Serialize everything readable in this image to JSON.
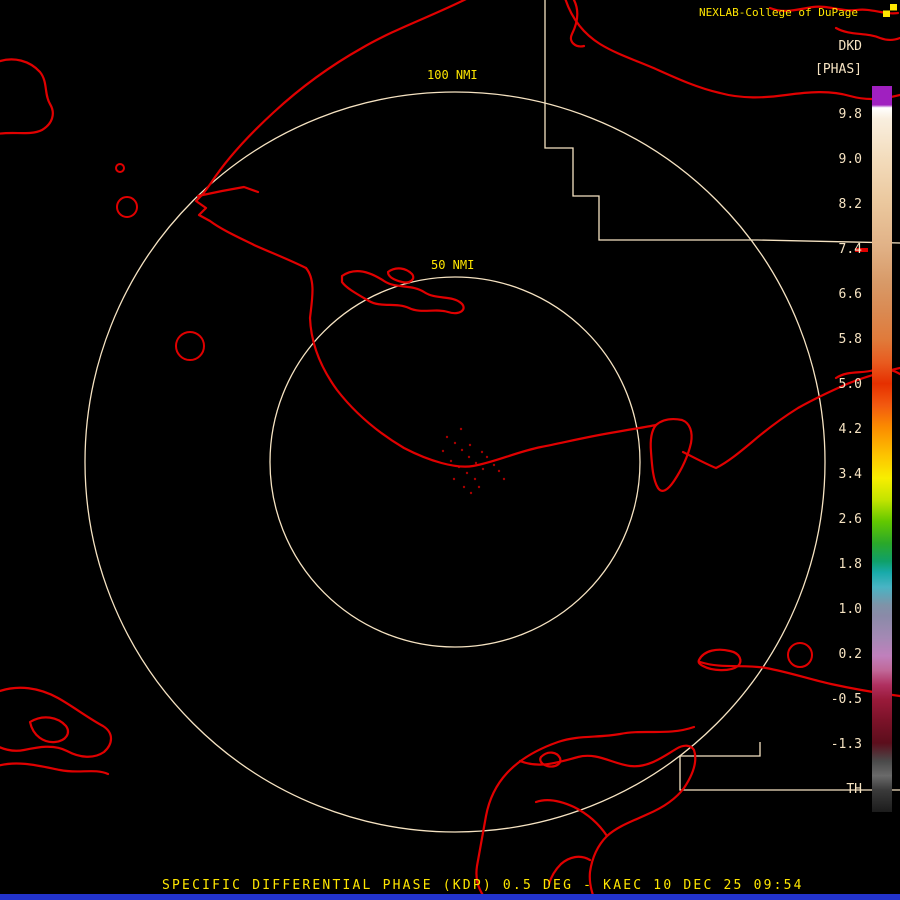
{
  "header": {
    "title": "NEXLAB-College of DuPage",
    "product_code": "DKD",
    "product_units": "[PHAS]"
  },
  "rings": {
    "outer_label": "100 NMI",
    "inner_label": "50 NMI"
  },
  "colorbar": {
    "tick_labels": [
      "9.8",
      "9.0",
      "8.2",
      "7.4",
      "6.6",
      "5.8",
      "5.0",
      "4.2",
      "3.4",
      "2.6",
      "1.8",
      "1.0",
      "0.2",
      "-0.5",
      "-1.3",
      "TH"
    ],
    "gradient_stops": [
      {
        "pos": 0,
        "color": "#a020c0"
      },
      {
        "pos": 2.6,
        "color": "#a020c0"
      },
      {
        "pos": 3.0,
        "color": "#ffffff"
      },
      {
        "pos": 4.5,
        "color": "#f9efdf"
      },
      {
        "pos": 10,
        "color": "#f3dcbc"
      },
      {
        "pos": 16,
        "color": "#ebc89e"
      },
      {
        "pos": 22,
        "color": "#e1b287"
      },
      {
        "pos": 27,
        "color": "#d89a68"
      },
      {
        "pos": 31,
        "color": "#da8a52"
      },
      {
        "pos": 35,
        "color": "#e07a3a"
      },
      {
        "pos": 38,
        "color": "#e85c20"
      },
      {
        "pos": 41,
        "color": "#e63000"
      },
      {
        "pos": 44,
        "color": "#f25a10"
      },
      {
        "pos": 47,
        "color": "#fb8c00"
      },
      {
        "pos": 51,
        "color": "#fdc500"
      },
      {
        "pos": 54,
        "color": "#f8ee00"
      },
      {
        "pos": 57,
        "color": "#c3e400"
      },
      {
        "pos": 60,
        "color": "#62c800"
      },
      {
        "pos": 63,
        "color": "#2aa82a"
      },
      {
        "pos": 65.5,
        "color": "#0fa06a"
      },
      {
        "pos": 67,
        "color": "#18aaaa"
      },
      {
        "pos": 69,
        "color": "#49b4c4"
      },
      {
        "pos": 71.5,
        "color": "#7f93a8"
      },
      {
        "pos": 73,
        "color": "#8a8aa8"
      },
      {
        "pos": 76,
        "color": "#a489b4"
      },
      {
        "pos": 78.5,
        "color": "#c080bc"
      },
      {
        "pos": 80.5,
        "color": "#c06898"
      },
      {
        "pos": 82.5,
        "color": "#b03060"
      },
      {
        "pos": 84.5,
        "color": "#9a1a3a"
      },
      {
        "pos": 87.5,
        "color": "#7a1228"
      },
      {
        "pos": 90.5,
        "color": "#5c0e1c"
      },
      {
        "pos": 93,
        "color": "#4a4a4a"
      },
      {
        "pos": 95,
        "color": "#6a6a6a"
      },
      {
        "pos": 97,
        "color": "#3a3a3a"
      },
      {
        "pos": 100,
        "color": "#1c1c1c"
      }
    ]
  },
  "footer": {
    "caption": "SPECIFIC DIFFERENTIAL PHASE (KDP) 0.5 DEG - KAEC 10 DEC 25 09:54"
  },
  "colors": {
    "bg": "#000000",
    "yellow": "#ffe600",
    "cream": "#f6e3c2",
    "map-red": "#e00000",
    "blue-bar": "#2233cc"
  }
}
